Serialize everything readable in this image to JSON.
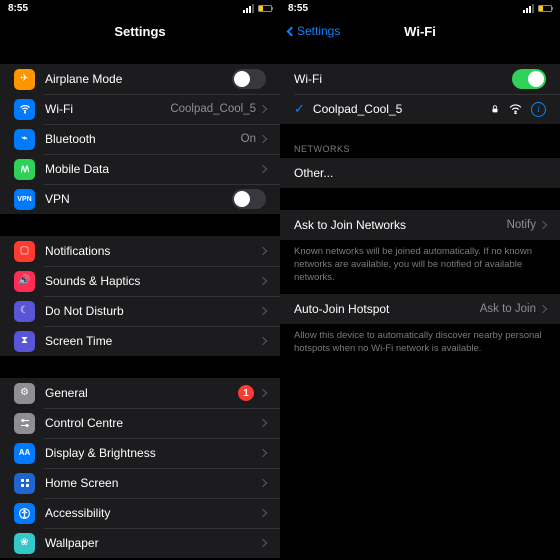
{
  "status": {
    "time": "8:55",
    "battery_pct": 35
  },
  "left": {
    "title": "Settings",
    "g1": {
      "airplane_label": "Airplane Mode",
      "airplane_on": false,
      "wifi_label": "Wi-Fi",
      "wifi_value": "Coolpad_Cool_5",
      "bt_label": "Bluetooth",
      "bt_value": "On",
      "mobile_label": "Mobile Data",
      "vpn_label": "VPN",
      "vpn_on": false
    },
    "g2": {
      "notif_label": "Notifications",
      "sounds_label": "Sounds & Haptics",
      "dnd_label": "Do Not Disturb",
      "screentime_label": "Screen Time"
    },
    "g3": {
      "general_label": "General",
      "general_badge": "1",
      "control_label": "Control Centre",
      "display_label": "Display & Brightness",
      "home_label": "Home Screen",
      "access_label": "Accessibility",
      "wallpaper_label": "Wallpaper"
    }
  },
  "right": {
    "back": "Settings",
    "title": "Wi-Fi",
    "wifi_toggle_label": "Wi-Fi",
    "wifi_on": true,
    "connected_name": "Coolpad_Cool_5",
    "networks_header": "NETWORKS",
    "other_label": "Other...",
    "ask_label": "Ask to Join Networks",
    "ask_value": "Notify",
    "ask_footer": "Known networks will be joined automatically. If no known networks are available, you will be notified of available networks.",
    "auto_label": "Auto-Join Hotspot",
    "auto_value": "Ask to Join",
    "auto_footer": "Allow this device to automatically discover nearby personal hotspots when no Wi-Fi network is available."
  }
}
